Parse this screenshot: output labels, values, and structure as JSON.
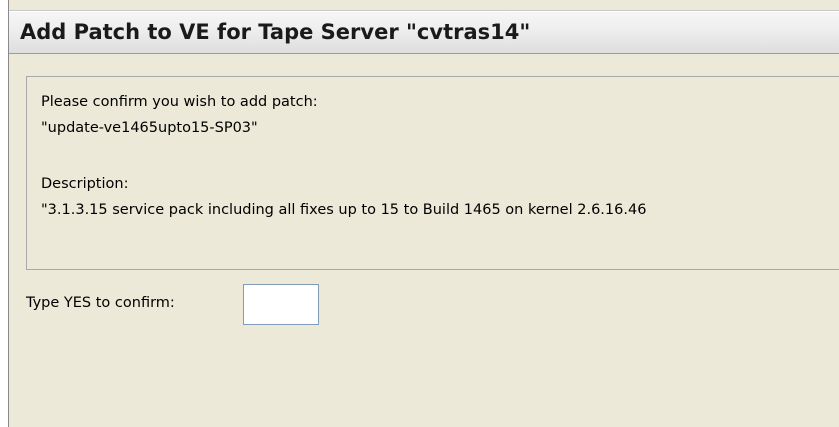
{
  "dialog": {
    "title": "Add Patch to VE for Tape Server \"cvtras14\""
  },
  "message": {
    "prompt": "Please confirm you wish to add patch:",
    "patch_name": "\"update-ve1465upto15-SP03\"",
    "description_label": "Description:",
    "description_value": "\"3.1.3.15 service pack including all fixes up to 15 to Build 1465 on kernel 2.6.16.46"
  },
  "confirm": {
    "label": "Type YES to confirm:",
    "value": ""
  },
  "colors": {
    "dialog_background": "#ece9d8",
    "input_border": "#7f9db9"
  }
}
